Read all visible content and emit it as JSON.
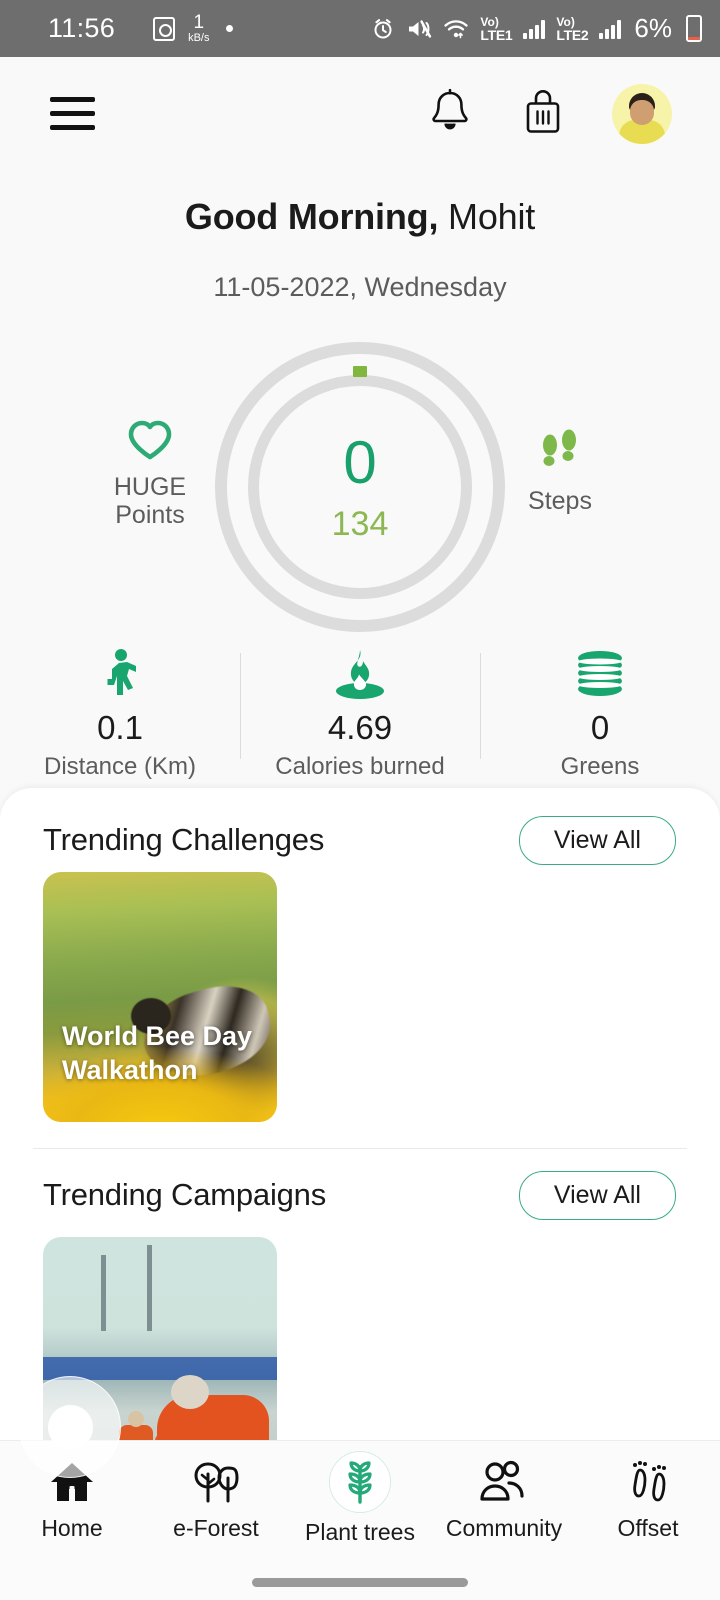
{
  "status_bar": {
    "time": "11:56",
    "data_rate": "1",
    "data_rate_unit": "kB/s",
    "alarm_icon": "alarm-icon",
    "mute_icon": "mute-icon",
    "wifi_icon": "wifi-icon",
    "sim1_label_top": "Vo)",
    "sim1_label": "LTE1",
    "sim2_label_top": "Vo)",
    "sim2_label": "LTE2",
    "battery_percent": "6%"
  },
  "header": {
    "menu_icon": "hamburger-menu-icon",
    "bell_icon": "notification-bell-icon",
    "bag_icon": "shopping-bag-icon",
    "avatar_icon": "user-avatar"
  },
  "greeting": {
    "salutation": "Good Morning,",
    "name": " Mohit",
    "date": "11-05-2022, Wednesday"
  },
  "activity_ring": {
    "main_value": "0",
    "sub_value": "134",
    "left_stat": {
      "icon": "heart-icon",
      "label_line1": "HUGE",
      "label_line2": "Points"
    },
    "right_stat": {
      "icon": "footsteps-icon",
      "label": "Steps"
    }
  },
  "stats": [
    {
      "icon": "walking-person-icon",
      "value": "0.1",
      "label": "Distance (Km)"
    },
    {
      "icon": "flame-icon",
      "value": "4.69",
      "label": "Calories burned"
    },
    {
      "icon": "coins-stack-icon",
      "value": "0",
      "label": "Greens"
    }
  ],
  "sections": [
    {
      "title": "Trending Challenges",
      "view_all": "View All",
      "card": {
        "caption_line1": "World Bee Day",
        "caption_line2": "Walkathon"
      }
    },
    {
      "title": "Trending Campaigns",
      "view_all": "View All",
      "card": {
        "caption_line1": "",
        "caption_line2": ""
      }
    }
  ],
  "bottom_nav": [
    {
      "icon": "home-icon",
      "label": "Home",
      "active": false
    },
    {
      "icon": "trees-icon",
      "label": "e-Forest",
      "active": false
    },
    {
      "icon": "sapling-icon",
      "label": "Plant trees",
      "active": true
    },
    {
      "icon": "community-people-icon",
      "label": "Community",
      "active": false
    },
    {
      "icon": "footprints-icon",
      "label": "Offset",
      "active": false
    }
  ],
  "floating_widget": {
    "icon": "floating-record-ring"
  },
  "colors": {
    "accent_green": "#1aa06a",
    "light_green": "#8cb752",
    "outline_green": "#3bab84",
    "status_bar_bg": "#6e6e6e",
    "page_bg": "#f8f9f8",
    "ring_track": "#dcdcdc",
    "battery_low": "#e8604a"
  }
}
